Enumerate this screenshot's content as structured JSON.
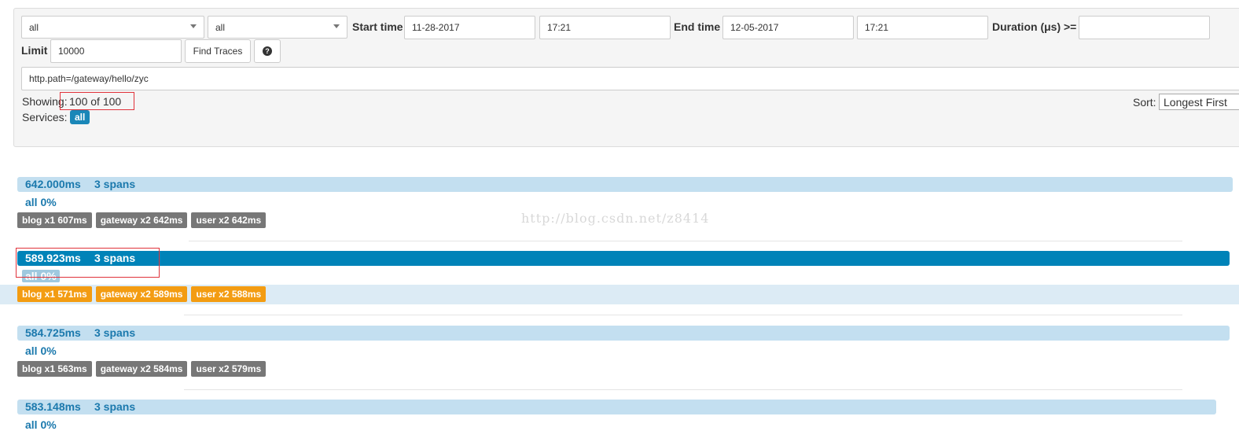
{
  "filters": {
    "service_select": "all",
    "span_select": "all",
    "start_label": "Start time",
    "start_date": "11-28-2017",
    "start_time": "17:21",
    "end_label": "End time",
    "end_date": "12-05-2017",
    "end_time": "17:21",
    "duration_label": "Duration (μs) >=",
    "duration_value": "",
    "limit_label": "Limit",
    "limit_value": "10000",
    "find_button": "Find Traces",
    "help_icon": "question-circle-icon",
    "help_glyph": "?",
    "query": "http.path=/gateway/hello/zyc"
  },
  "summary": {
    "showing_label": "Showing:",
    "showing_value": "100 of 100",
    "services_label": "Services:",
    "services_badge": "all",
    "sort_label": "Sort:",
    "sort_value": "Longest First"
  },
  "watermark": "http://blog.csdn.net/z8414",
  "colors": {
    "accent": "#0083b8",
    "bar_light": "#c3dff0",
    "tag_gray": "#777777",
    "tag_orange": "#f39c12",
    "highlight_box": "#e0333b"
  },
  "traces": [
    {
      "duration": "642.000ms",
      "spans": "3 spans",
      "sub": "all 0%",
      "tags": [
        "blog x1 607ms",
        "gateway x2 642ms",
        "user x2 642ms"
      ],
      "selected": false
    },
    {
      "duration": "589.923ms",
      "spans": "3 spans",
      "sub": "all 0%",
      "tags": [
        "blog x1 571ms",
        "gateway x2 589ms",
        "user x2 588ms"
      ],
      "selected": true
    },
    {
      "duration": "584.725ms",
      "spans": "3 spans",
      "sub": "all 0%",
      "tags": [
        "blog x1 563ms",
        "gateway x2 584ms",
        "user x2 579ms"
      ],
      "selected": false
    },
    {
      "duration": "583.148ms",
      "spans": "3 spans",
      "sub": "all 0%",
      "tags": [],
      "selected": false
    }
  ]
}
